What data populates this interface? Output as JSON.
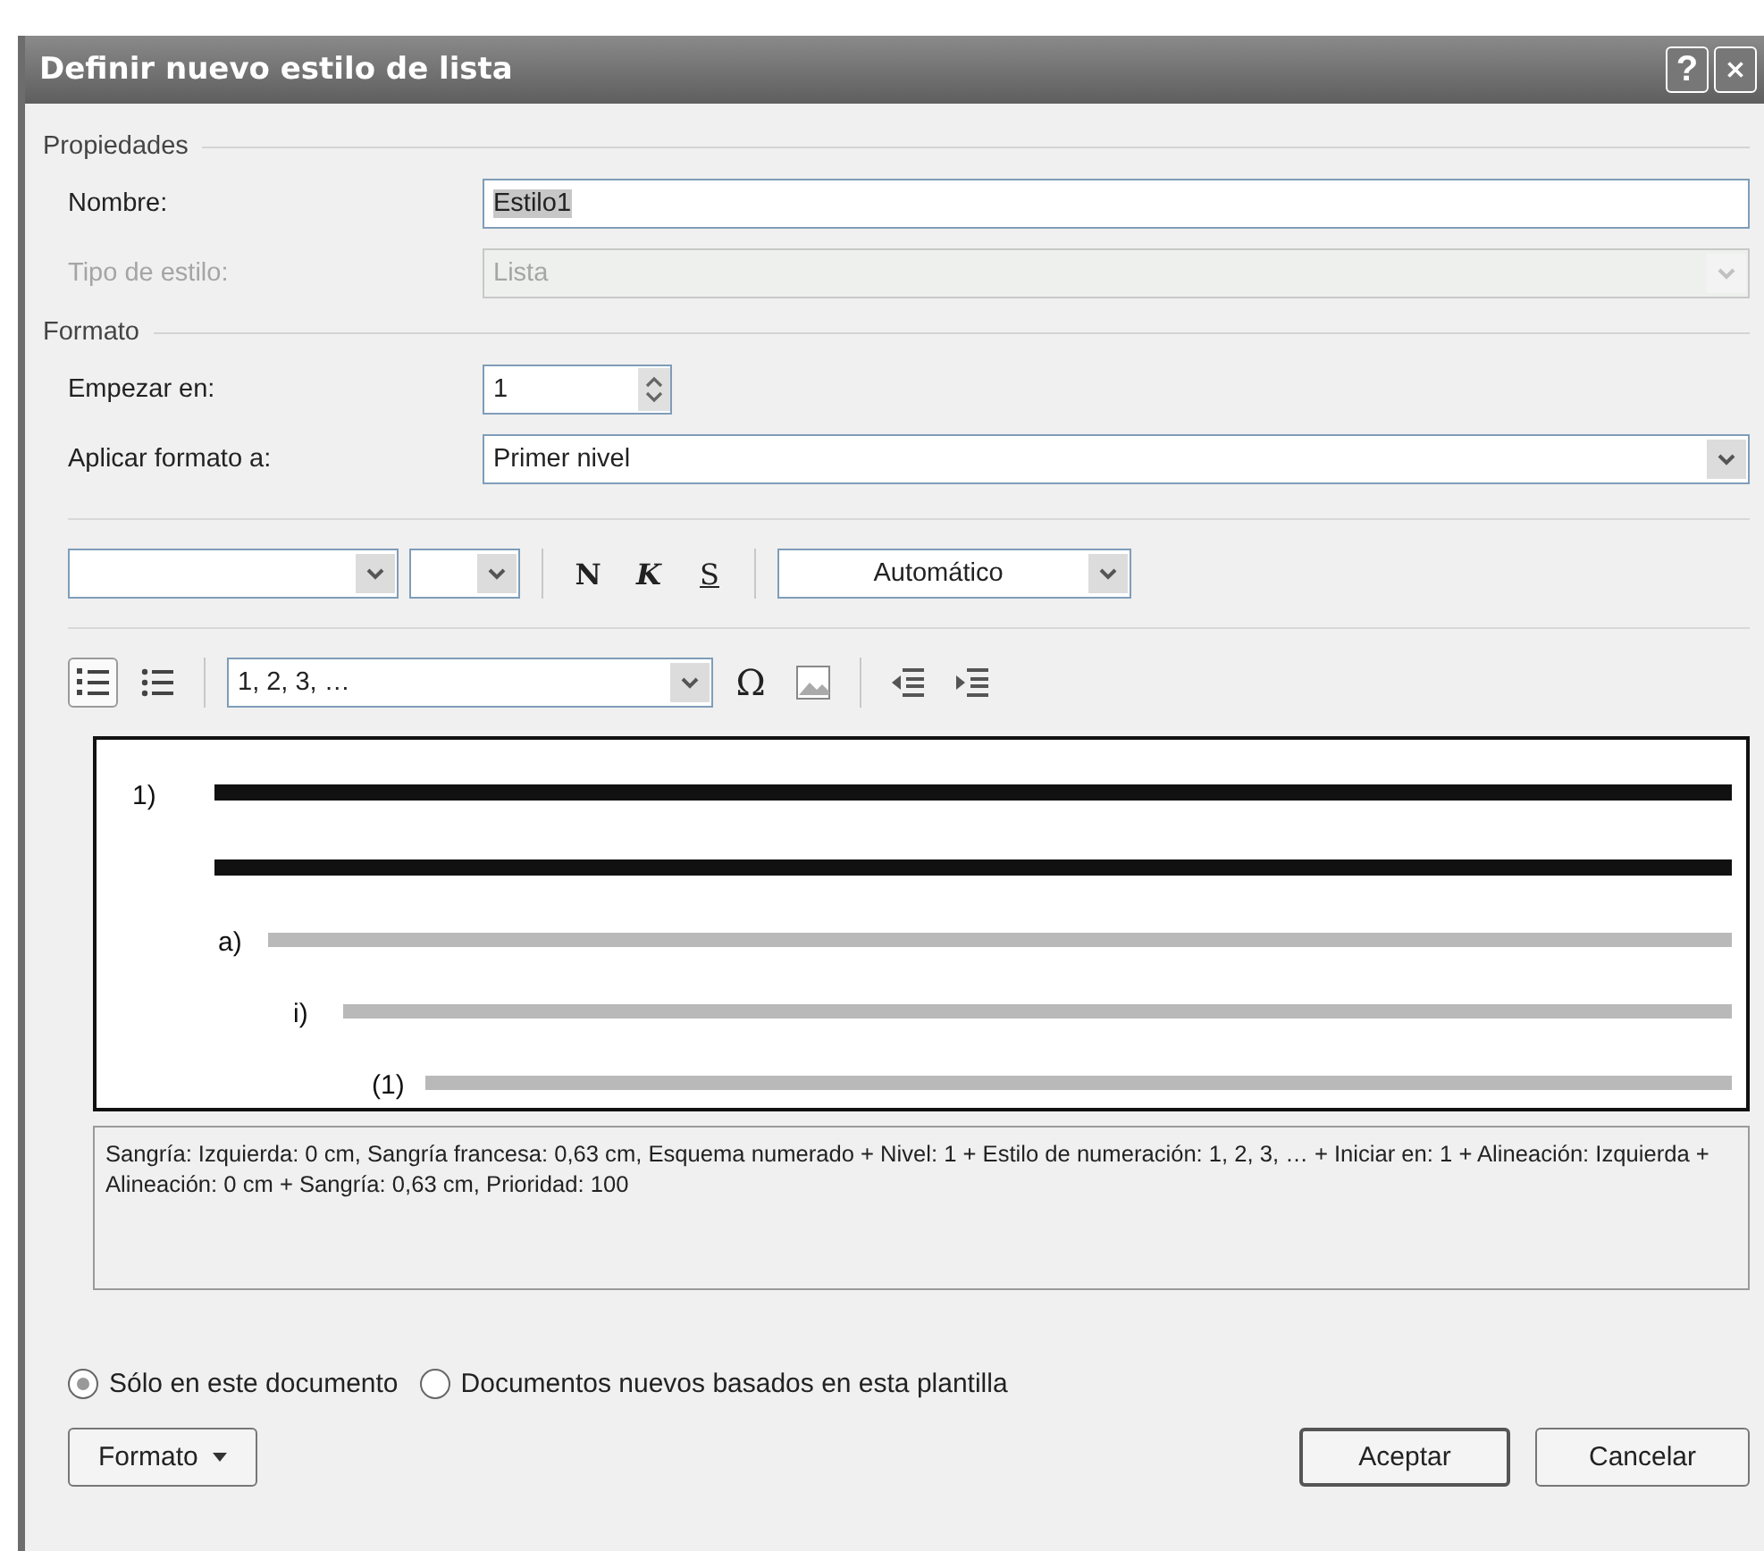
{
  "window": {
    "title": "Definir nuevo estilo de lista",
    "help_button": "?"
  },
  "properties": {
    "heading": "Propiedades",
    "name": {
      "label": "Nombre:",
      "value": "Estilo1"
    },
    "style_type": {
      "label": "Tipo de estilo:",
      "value": "Lista",
      "disabled": true
    }
  },
  "format": {
    "heading": "Formato",
    "start_at": {
      "label": "Empezar en:",
      "value": "1"
    },
    "apply_to": {
      "label": "Aplicar formato a:",
      "value": "Primer nivel"
    },
    "font_toolbar": {
      "bold": "N",
      "italic": "K",
      "underline": "S",
      "font_color_label": "Automático"
    },
    "numbering_toolbar": {
      "numbered_selected": true,
      "bulleted_selected": false,
      "style": "1, 2, 3, …",
      "symbol": "Ω"
    },
    "preview": [
      {
        "marker": "1)",
        "children": [
          {
            "marker": "a)",
            "children": [
              {
                "marker": "i)",
                "children": [
                  {
                    "marker": "(1)"
                  }
                ]
              }
            ]
          }
        ]
      }
    ],
    "description": "Sangría: Izquierda:  0 cm, Sangría francesa:  0,63 cm, Esquema numerado + Nivel: 1 + Estilo de numeración: 1, 2, 3, … + Iniciar en: 1 + Alineación: Izquierda + Alineación:  0 cm + Sangría:  0,63 cm, Prioridad: 100"
  },
  "scope_options": [
    {
      "label": "Sólo en este documento",
      "selected": true
    },
    {
      "label": "Documentos nuevos basados en esta plantilla",
      "selected": false
    }
  ],
  "buttons": {
    "format": "Formato",
    "ok": "Aceptar",
    "cancel": "Cancelar"
  }
}
